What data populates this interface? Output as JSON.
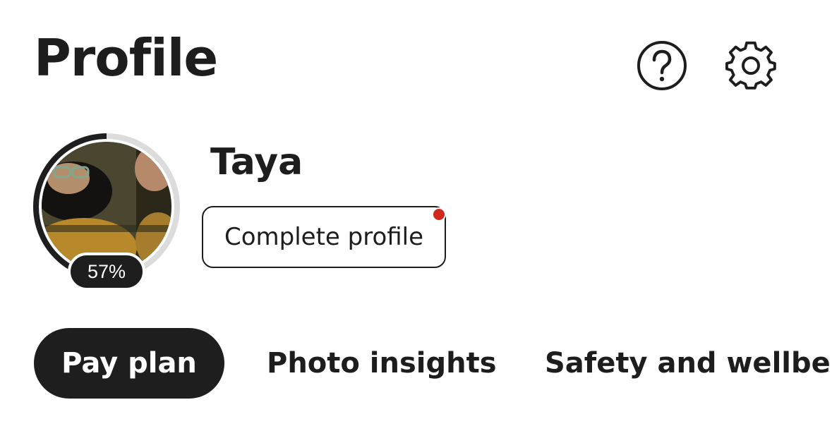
{
  "header": {
    "title": "Profile",
    "help_icon": "question-circle-icon",
    "settings_icon": "gear-icon"
  },
  "profile": {
    "name": "Taya",
    "completion_percent": 57,
    "completion_label": "57%",
    "complete_button_label": "Complete profile",
    "has_notification": true
  },
  "tabs": [
    {
      "label": "Pay plan",
      "active": true
    },
    {
      "label": "Photo insights",
      "active": false
    },
    {
      "label": "Safety and wellbeing",
      "active": false
    }
  ],
  "colors": {
    "text": "#1d1d1d",
    "active_tab_bg": "#1e1e1e",
    "notification": "#d0291b",
    "ring_track": "#dcdcdc",
    "ring_progress": "#1e1e1e"
  }
}
